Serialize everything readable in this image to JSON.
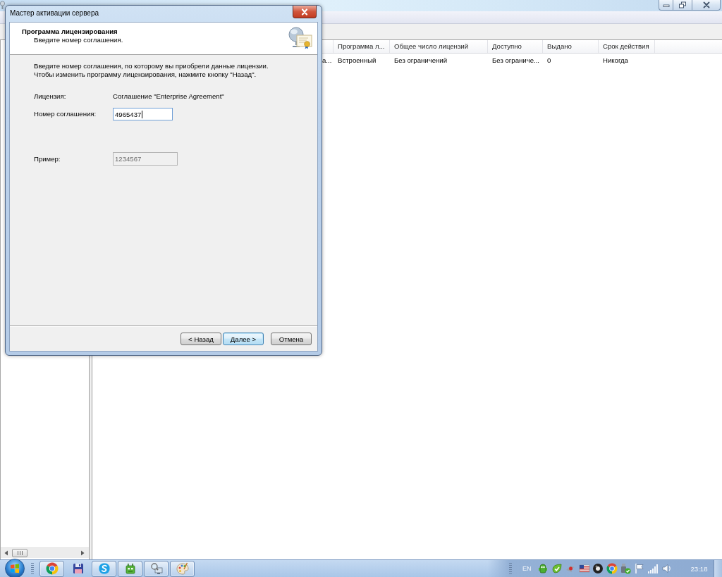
{
  "main_window": {
    "list": {
      "columns": [
        "Программа л...",
        "Общее число лицензий",
        "Доступно",
        "Выдано",
        "Срок действия"
      ],
      "rows": [
        {
          "column_1": "а...",
          "cells": [
            "Встроенный",
            "Без ограничений",
            "Без ограниче...",
            "0",
            "Никогда"
          ]
        }
      ]
    }
  },
  "dialog": {
    "title": "Мастер активации сервера",
    "header": {
      "title": "Программа лицензирования",
      "subtitle": "Введите номер соглашения."
    },
    "instructions": [
      "Введите номер соглашения, по которому вы приобрели данные лицензии.",
      "Чтобы изменить программу лицензирования, нажмите кнопку \"Назад\"."
    ],
    "license": {
      "label": "Лицензия:",
      "value": "Соглашение \"Enterprise Agreement\""
    },
    "agreement_number": {
      "label": "Номер соглашения:",
      "value": "4965437",
      "focused": true
    },
    "example": {
      "label": "Пример:",
      "value": "1234567",
      "disabled": true
    },
    "buttons": [
      {
        "label": "< Назад",
        "default": false
      },
      {
        "label": "Далее >",
        "default": true
      },
      {
        "label": "Отмена",
        "default": false
      }
    ]
  },
  "taskbar": {
    "items": [
      {
        "kind": "ring",
        "running": true
      },
      {
        "kind": "floppy",
        "running": false
      },
      {
        "kind": "bubble",
        "running": true
      },
      {
        "kind": "robot",
        "running": true
      },
      {
        "kind": "monitor",
        "running": true
      },
      {
        "kind": "palette",
        "running": true
      }
    ],
    "language": "EN",
    "clock": "23:18"
  }
}
